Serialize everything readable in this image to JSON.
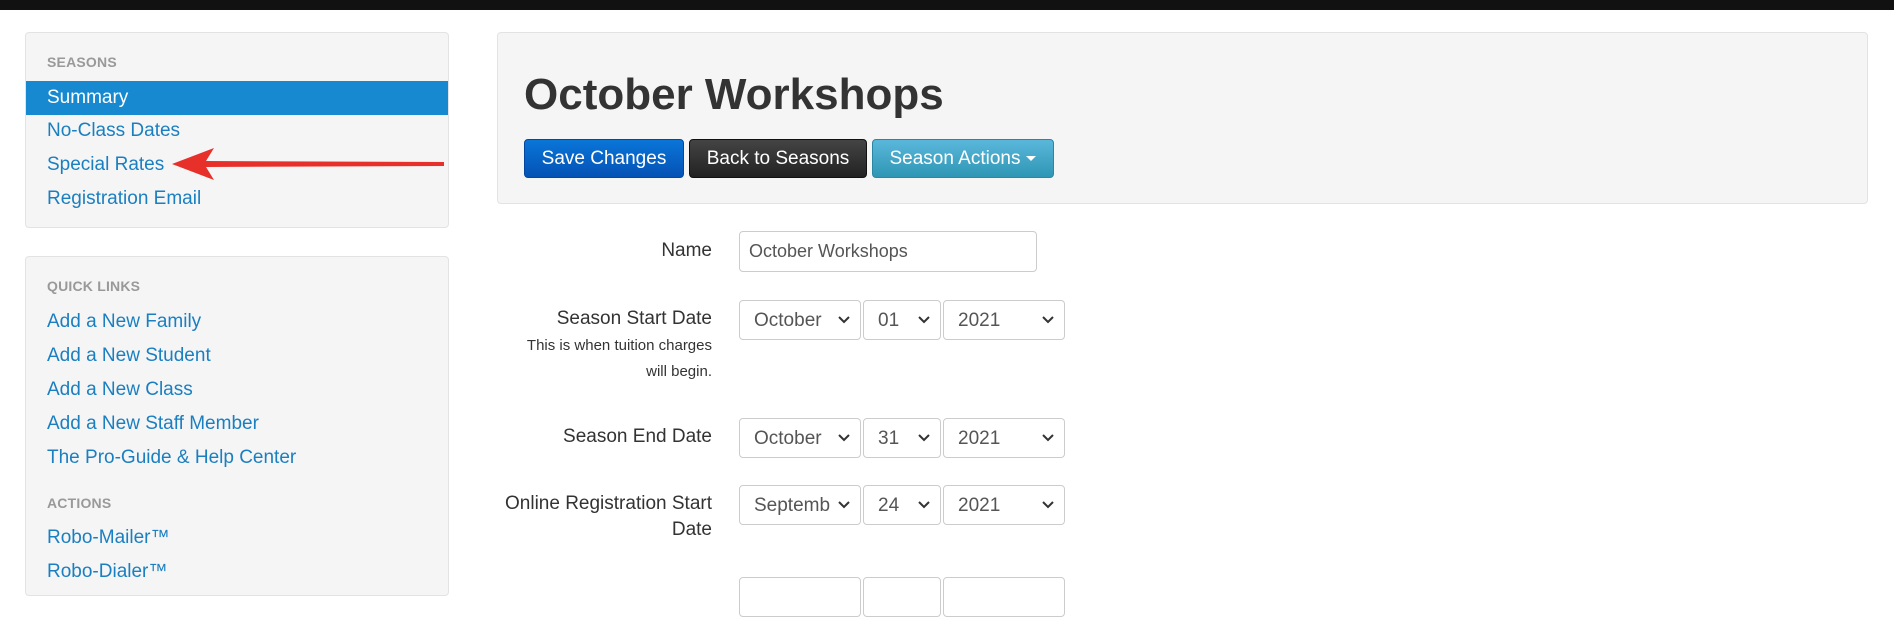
{
  "sidebar": {
    "seasons_header": "SEASONS",
    "seasons_items": [
      "Summary",
      "No-Class Dates",
      "Special Rates",
      "Registration Email"
    ],
    "quick_links_header": "QUICK LINKS",
    "quick_links": [
      "Add a New Family",
      "Add a New Student",
      "Add a New Class",
      "Add a New Staff Member",
      "The Pro-Guide & Help Center"
    ],
    "actions_header": "ACTIONS",
    "actions": [
      "Robo-Mailer™",
      "Robo-Dialer™"
    ]
  },
  "header": {
    "title": "October Workshops",
    "save_label": "Save Changes",
    "back_label": "Back to Seasons",
    "actions_label": "Season Actions"
  },
  "form": {
    "name_label": "Name",
    "name_value": "October Workshops",
    "start_label": "Season Start Date",
    "start_help_1": "This is when tuition charges",
    "start_help_2": "will begin.",
    "start": {
      "month": "October",
      "day": "01",
      "year": "2021"
    },
    "end_label": "Season End Date",
    "end": {
      "month": "October",
      "day": "31",
      "year": "2021"
    },
    "reg_label_1": "Online Registration Start",
    "reg_label_2": "Date",
    "reg": {
      "month": "September",
      "day": "24",
      "year": "2021"
    }
  },
  "colors": {
    "accent": "#1689d0",
    "link": "#1a7fc1",
    "annotation_arrow": "#e8302a"
  }
}
